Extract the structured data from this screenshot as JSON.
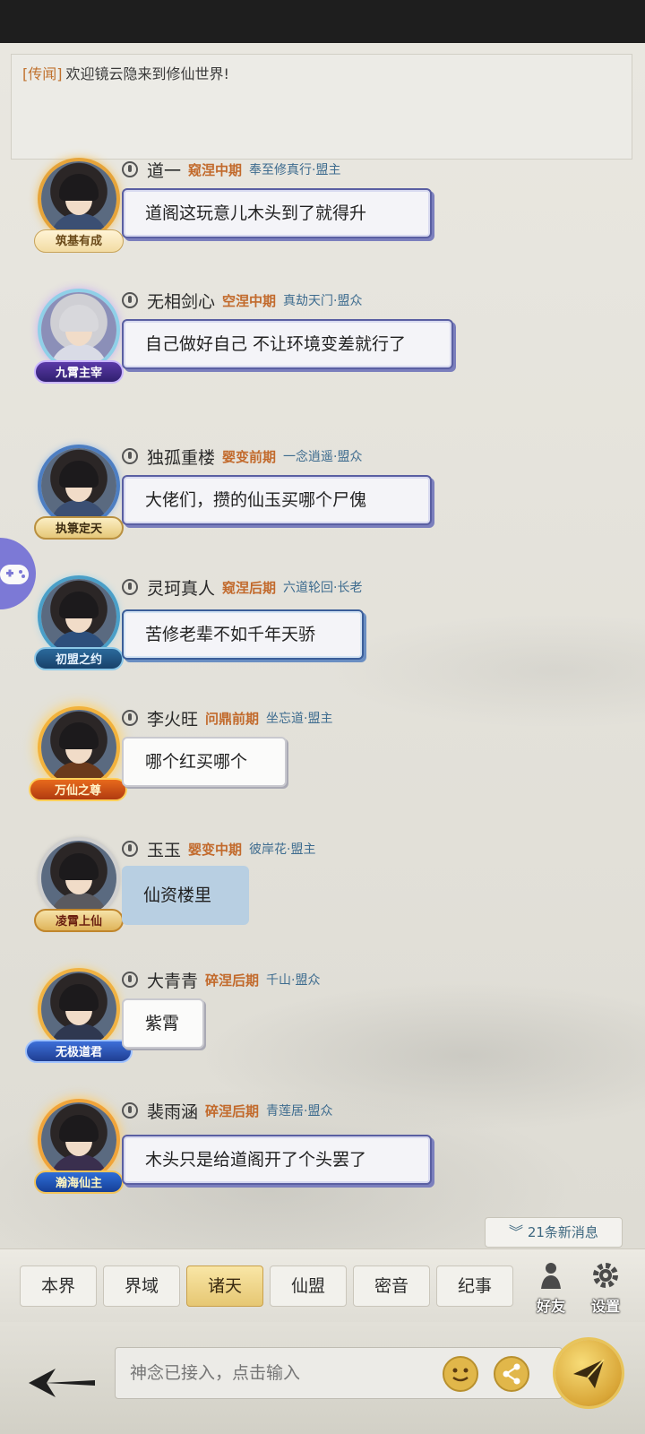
{
  "notice": {
    "tag": "[传闻]",
    "text": "欢迎镜云隐来到修仙世界!"
  },
  "messages": [
    {
      "name": "道一",
      "realm": "窥涅中期",
      "sect": "奉至修真行·盟主",
      "badge": "筑基有成",
      "text": "道阁这玩意儿木头到了就得升"
    },
    {
      "name": "无相剑心",
      "realm": "空涅中期",
      "sect": "真劫天门·盟众",
      "badge": "九霄主宰",
      "text": "自己做好自己 不让环境变差就行了"
    },
    {
      "name": "独孤重楼",
      "realm": "婴变前期",
      "sect": "一念逍遥·盟众",
      "badge": "执箓定天",
      "text": "大佬们，攒的仙玉买哪个尸傀"
    },
    {
      "name": "灵珂真人",
      "realm": "窥涅后期",
      "sect": "六道轮回·长老",
      "badge": "初盟之约",
      "text": "苦修老辈不如千年天骄"
    },
    {
      "name": "李火旺",
      "realm": "问鼎前期",
      "sect": "坐忘道·盟主",
      "badge": "万仙之尊",
      "text": "哪个红买哪个"
    },
    {
      "name": "玉玉",
      "realm": "婴变中期",
      "sect": "彼岸花·盟主",
      "badge": "凌霄上仙",
      "text": "仙资楼里"
    },
    {
      "name": "大青青",
      "realm": "碎涅后期",
      "sect": "千山·盟众",
      "badge": "无极道君",
      "text": "紫霄"
    },
    {
      "name": "裴雨涵",
      "realm": "碎涅后期",
      "sect": "青莲居·盟众",
      "badge": "瀚海仙主",
      "text": "木头只是给道阁开了个头罢了"
    }
  ],
  "new_messages": "21条新消息",
  "tabs": [
    "本界",
    "界域",
    "诸天",
    "仙盟",
    "密音",
    "纪事"
  ],
  "active_tab": "诸天",
  "side_buttons": {
    "friends": "好友",
    "settings": "设置"
  },
  "input": {
    "placeholder": "神念已接入，点击输入"
  },
  "colors": {
    "accent_gold": "#e6c773",
    "realm_orange": "#c26a2c",
    "sect_blue": "#3e6c8f",
    "bubble_purple": "#5a5fa2"
  }
}
